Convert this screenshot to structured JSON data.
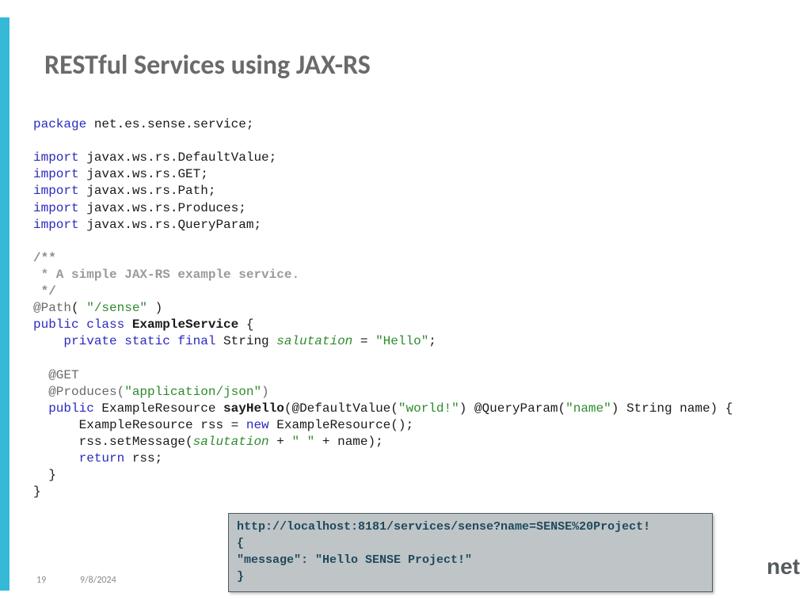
{
  "title": "RESTful Services using JAX-RS",
  "code": {
    "pkg": "net.es.sense.service;",
    "imports": [
      "javax.ws.rs.DefaultValue;",
      "javax.ws.rs.GET;",
      "javax.ws.rs.Path;",
      "javax.ws.rs.Produces;",
      "javax.ws.rs.QueryParam;"
    ],
    "comment_open": "/**",
    "comment_body": " * A simple JAX-RS example service.",
    "comment_close": " */",
    "path_ann": "@Path",
    "path_val": "\"/sense\"",
    "class_decl_pre": "public class ",
    "class_name": "ExampleService",
    "class_decl_post": " {",
    "field_mods": "    private static final",
    "field_type": " String ",
    "field_name": "salutation",
    "field_assign": " = ",
    "field_val": "\"Hello\"",
    "get_ann": "  @GET",
    "produces_ann": "  @Produces(",
    "produces_val": "\"application/json\"",
    "produces_close": ")",
    "method_mods": "  public",
    "method_ret": " ExampleResource ",
    "method_name": "sayHello",
    "method_params_open": "(@DefaultValue(",
    "default_val": "\"world!\"",
    "method_params_mid": ") @QueryParam(",
    "qp_val": "\"name\"",
    "method_params_close": ") String name) {",
    "body1_pre": "      ExampleResource rss = ",
    "body1_new": "new",
    "body1_post": " ExampleResource();",
    "body2_pre": "      rss.setMessage(",
    "body2_sal": "salutation",
    "body2_plus": " + ",
    "body2_space": "\" \"",
    "body2_plus2": " + name);",
    "body3_pre": "      ",
    "body3_ret": "return",
    "body3_post": " rss;",
    "close_method": "  }",
    "close_class": "}"
  },
  "response": {
    "url": "http://localhost:8181/services/sense?name=SENSE%20Project!",
    "open": "{",
    "body": "    \"message\": \"Hello SENSE Project!\"",
    "close": "}"
  },
  "footer": {
    "page": "19",
    "date": "9/8/2024"
  },
  "logo": "net",
  "kw": {
    "package": "package",
    "import": "import"
  }
}
